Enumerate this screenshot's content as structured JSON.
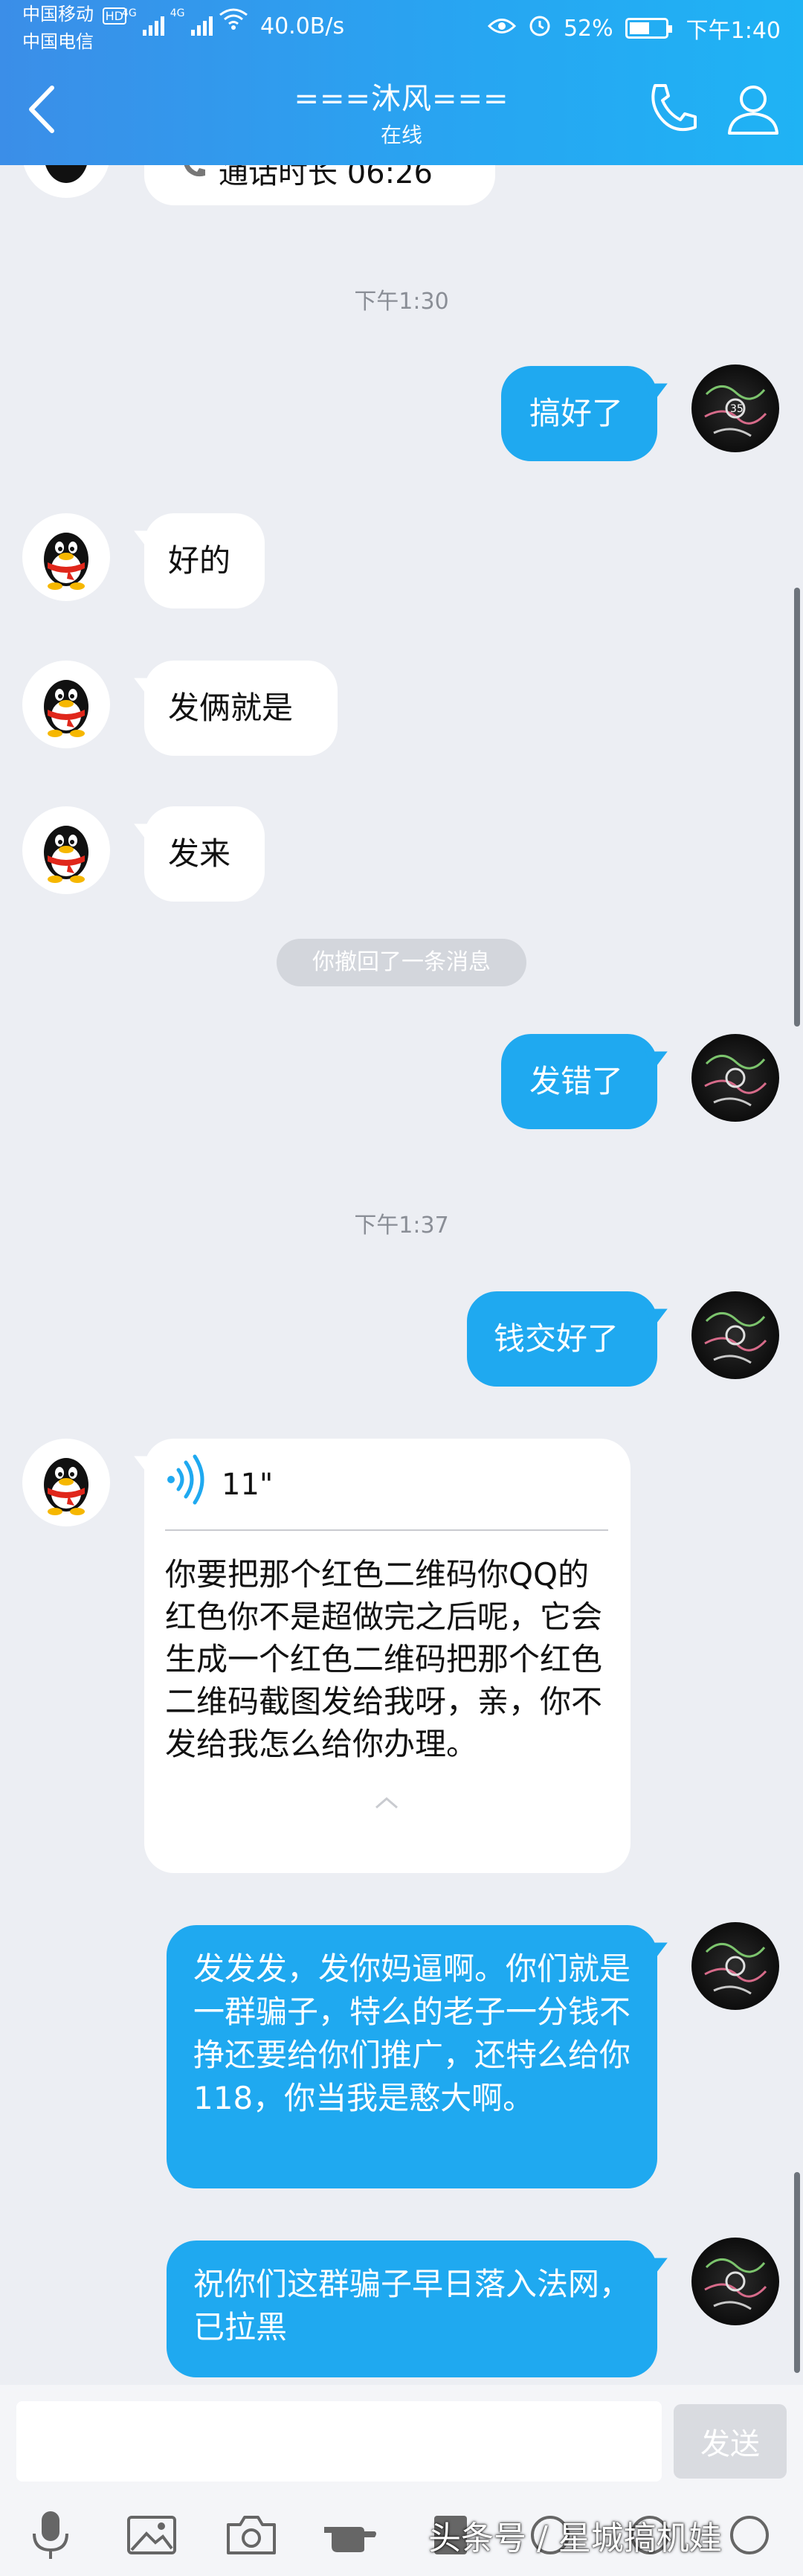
{
  "status_bar": {
    "carrier_1": "中国移动",
    "carrier_2": "中国电信",
    "hd": "HD",
    "net_1": "4G",
    "net_2": "4G",
    "speed": "40.0B/s",
    "battery": "52%",
    "time": "下午1:40"
  },
  "header": {
    "contact_name": "===沐风===",
    "contact_status": "在线"
  },
  "call_record": {
    "label": "通话时长 06:26"
  },
  "timestamps": {
    "t1": "下午1:30",
    "t2": "下午1:37"
  },
  "system": {
    "recalled": "你撤回了一条消息"
  },
  "messages": {
    "m1": "搞好了",
    "m2": "好的",
    "m3": "发俩就是",
    "m4": "发来",
    "m5": "发错了",
    "m6": "钱交好了",
    "m7_voice_len": "11\"",
    "m7_text": "你要把那个红色二维码你QQ的红色你不是超做完之后呢，它会生成一个红色二维码把那个红色二维码截图发给我呀，亲，你不发给我怎么给你办理。",
    "m8": "发发发，发你妈逼啊。你们就是一群骗子，特么的老子一分钱不挣还要给你们推广，还特么给你118，你当我是憨大啊。",
    "m9": "祝你们这群骗子早日落入法网，已拉黑"
  },
  "input": {
    "placeholder": "",
    "value": "",
    "send_label": "发送"
  },
  "watermark": "头条号 / 星城搞机娃",
  "colors": {
    "header_start": "#3b8ee8",
    "header_end": "#1fb3f4",
    "out_bubble": "#1fa9f0",
    "background": "#eceef3"
  }
}
